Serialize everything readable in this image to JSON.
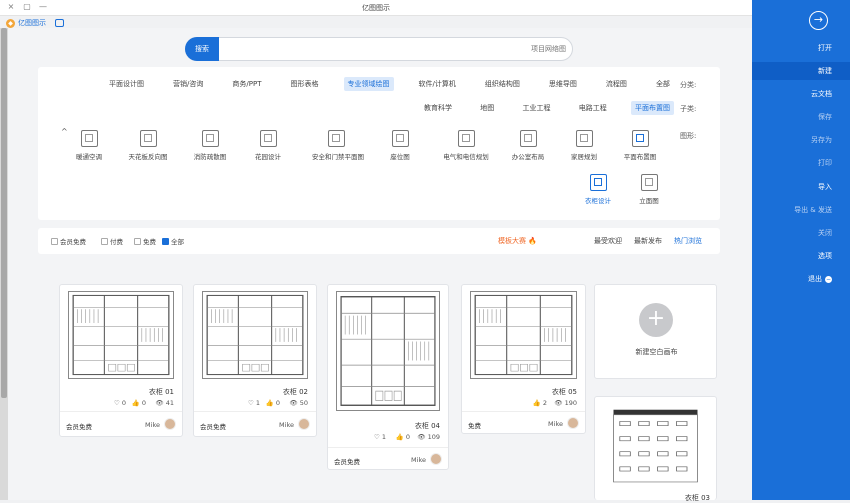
{
  "window": {
    "title": "亿图图示",
    "controls": [
      "×",
      "▢",
      "—"
    ]
  },
  "brand": {
    "name": "亿图图示"
  },
  "search": {
    "button": "搜索",
    "placeholder": "项目网络图"
  },
  "filters": {
    "type_label": "分类:",
    "types": [
      "全部",
      "流程图",
      "思维导图",
      "组织结构图",
      "软件/计算机",
      "专业领域绘图",
      "图形表格",
      "商务/PPT",
      "营销/咨询",
      "平面设计图"
    ],
    "sub_label": "子类:",
    "subtypes": [
      "平面布置图",
      "电路工程",
      "工业工程",
      "地图",
      "教育科学"
    ],
    "graphic_label": "图形:",
    "graphics": [
      "平面布置图",
      "家居规划",
      "办公室布局",
      "电气和电信规划",
      "座位图",
      "安全和门禁平面图",
      "花园设计",
      "消防疏散图",
      "天花板反向图",
      "暖通空调",
      "立面图",
      "衣柜设计"
    ],
    "collapse": "^"
  },
  "sortbar": {
    "tabs": [
      "热门浏览",
      "最新发布",
      "最受欢迎",
      "模板大赛"
    ],
    "checks": [
      "全部",
      "免费",
      "付费",
      "会员免费"
    ]
  },
  "new_card": {
    "label": "新建空白画布",
    "plus": "+"
  },
  "cards": [
    {
      "name": "衣柜 05",
      "views": "190",
      "likes": "2",
      "favs": "",
      "price": "免费",
      "author": "Mike"
    },
    {
      "name": "衣柜 04",
      "views": "109",
      "likes": "0",
      "favs": "1",
      "price": "会员免费",
      "author": "Mike"
    },
    {
      "name": "衣柜 02",
      "views": "50",
      "likes": "0",
      "favs": "1",
      "price": "会员免费",
      "author": "Mike"
    },
    {
      "name": "衣柜 01",
      "views": "41",
      "likes": "0",
      "favs": "0",
      "price": "会员免费",
      "author": "Mike"
    },
    {
      "name": "衣柜 03",
      "views": "",
      "likes": "",
      "favs": "",
      "price": "",
      "author": ""
    }
  ],
  "right_menu": {
    "items": [
      "打开",
      "新建",
      "云文档",
      "保存",
      "另存为",
      "打印",
      "导入",
      "导出 & 发送",
      "关闭",
      "选项",
      "退出"
    ]
  },
  "colors": {
    "accent": "#1a6fd8",
    "hot": "#f06a2a"
  }
}
